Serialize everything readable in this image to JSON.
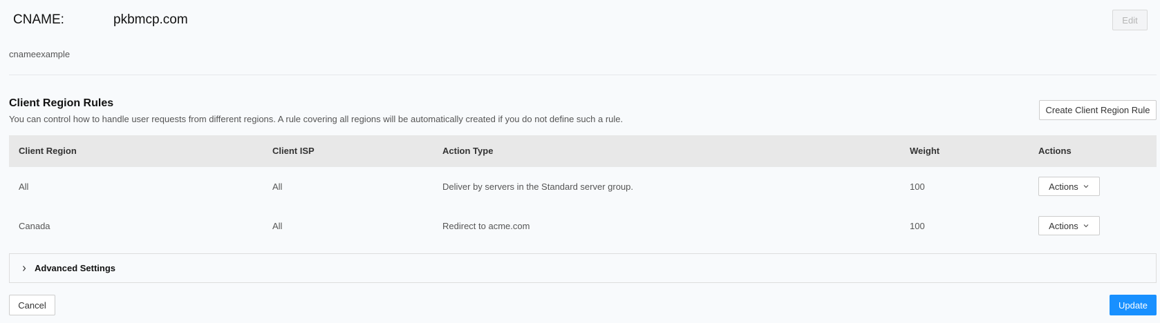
{
  "header": {
    "cname_label": "CNAME:",
    "cname_value": "pkbmcp.com",
    "edit_label": "Edit"
  },
  "description": "cnameexample",
  "section": {
    "title": "Client Region Rules",
    "description": "You can control how to handle user requests from different regions. A rule covering all regions will be automatically created if you do not define such a rule.",
    "create_label": "Create Client Region Rule"
  },
  "table": {
    "columns": [
      "Client Region",
      "Client ISP",
      "Action Type",
      "Weight",
      "Actions"
    ],
    "rows": [
      {
        "region": "All",
        "isp": "All",
        "action_type": "Deliver by servers in the Standard server group.",
        "weight": "100",
        "actions_label": "Actions"
      },
      {
        "region": "Canada",
        "isp": "All",
        "action_type": "Redirect to acme.com",
        "weight": "100",
        "actions_label": "Actions"
      }
    ]
  },
  "advanced": {
    "label": "Advanced Settings",
    "icon": "chevron-right-icon"
  },
  "footer": {
    "cancel_label": "Cancel",
    "update_label": "Update"
  },
  "colors": {
    "primary": "#1890ff",
    "background": "#f8fafc",
    "table_header": "#e8e8e8"
  }
}
